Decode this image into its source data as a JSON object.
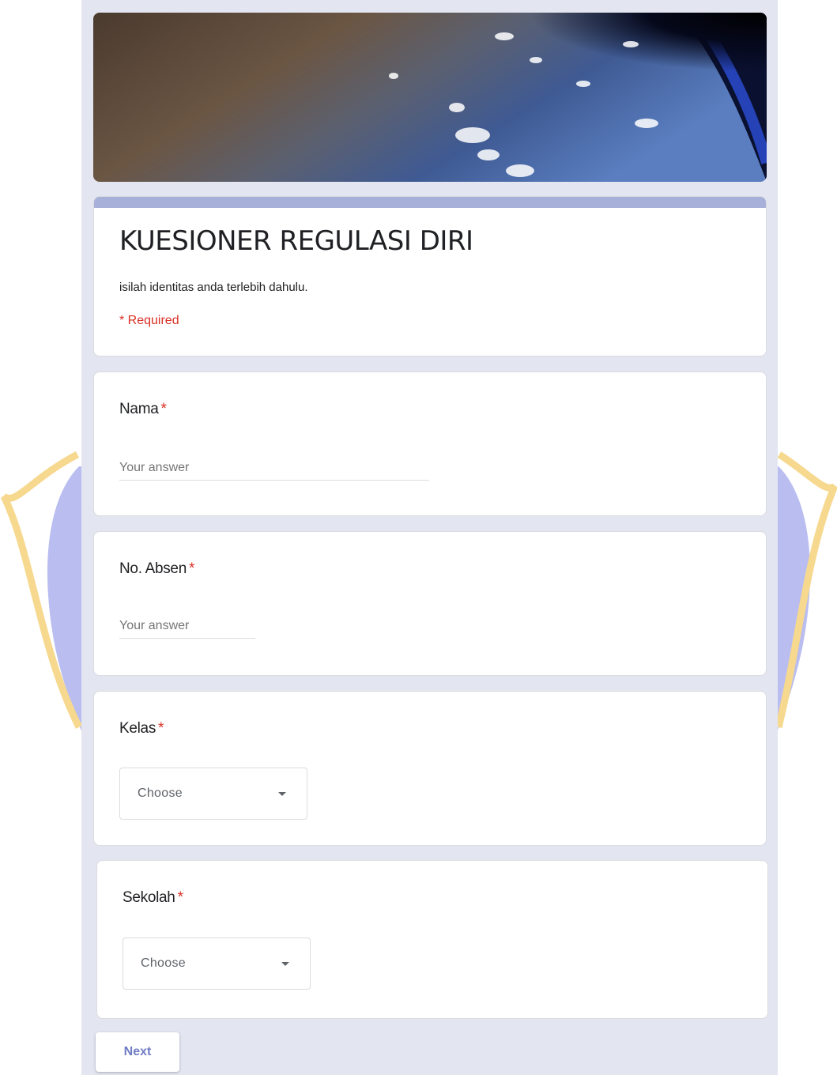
{
  "form": {
    "title": "KUESIONER REGULASI DIRI",
    "description": "isilah identitas anda terlebih dahulu.",
    "required_note": "* Required"
  },
  "questions": [
    {
      "label": "Nama",
      "star": "*",
      "type": "text",
      "placeholder": "Your answer"
    },
    {
      "label": "No. Absen",
      "star": "*",
      "type": "text",
      "placeholder": "Your answer"
    },
    {
      "label": "Kelas",
      "star": "*",
      "type": "dropdown",
      "selected": "Choose"
    },
    {
      "label": "Sekolah",
      "star": "*",
      "type": "dropdown",
      "selected": "Choose"
    }
  ],
  "next_label": "Next",
  "colors": {
    "background": "#e3e6f1",
    "accent": "#a7b0d8",
    "required": "#d93025",
    "button_text": "#6f7cc4",
    "watermark_gold": "#f6d98f",
    "watermark_blue": "#b9bdf0"
  },
  "icons": {
    "dropdown": "chevron-down-icon"
  }
}
